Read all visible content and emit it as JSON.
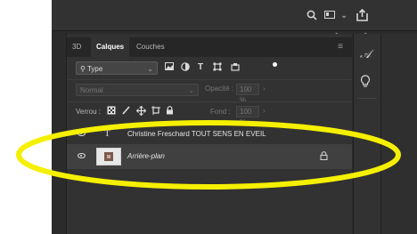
{
  "topbar": {
    "search_icon": "search-icon",
    "workspace_icon": "workspace-icon",
    "chevron": "⌄",
    "share_icon": "share-icon"
  },
  "panel": {
    "tabs": [
      {
        "label": "3D",
        "active": false
      },
      {
        "label": "Calques",
        "active": true
      },
      {
        "label": "Couches",
        "active": false
      }
    ],
    "menu_icon": "≡",
    "filter": {
      "kind_label": "Type",
      "icons": [
        "image-filter-icon",
        "adjustment-filter-icon",
        "type-filter-icon",
        "shape-filter-icon",
        "smart-object-filter-icon"
      ]
    },
    "blend": {
      "mode": "Normal",
      "opacity_label": "Opacité :",
      "opacity_value": "100 %"
    },
    "lock": {
      "label": "Verrou :",
      "fill_label": "Fond :",
      "fill_value": "100 %"
    },
    "layers": [
      {
        "name": "Christine Freschard TOUT SENS EN EVEIL",
        "type": "text",
        "visible": true
      },
      {
        "name": "Arrière-plan",
        "type": "image",
        "visible": true,
        "locked": true
      }
    ]
  },
  "dock": {
    "items": [
      "character-icon",
      "lightbulb-icon"
    ]
  },
  "annotation": {
    "color": "#f5f000"
  }
}
